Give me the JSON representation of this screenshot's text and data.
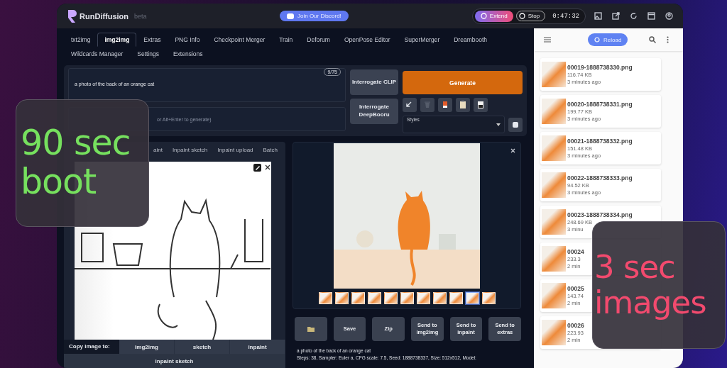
{
  "header": {
    "logo": "RunDiffusion",
    "badge": "beta",
    "discord_button": "Join Our Discord!",
    "extend_button": "Extend",
    "stop_button": "Stop",
    "timer": "0:47:32"
  },
  "tabs": [
    {
      "label": "txt2img",
      "selected": false
    },
    {
      "label": "img2img",
      "selected": true
    },
    {
      "label": "Extras",
      "selected": false
    },
    {
      "label": "PNG Info",
      "selected": false
    },
    {
      "label": "Checkpoint Merger",
      "selected": false
    },
    {
      "label": "Train",
      "selected": false
    },
    {
      "label": "Deforum",
      "selected": false
    },
    {
      "label": "OpenPose Editor",
      "selected": false
    },
    {
      "label": "SuperMerger",
      "selected": false
    },
    {
      "label": "Dreambooth",
      "selected": false
    },
    {
      "label": "Wildcards Manager",
      "selected": false
    },
    {
      "label": "Settings",
      "selected": false
    },
    {
      "label": "Extensions",
      "selected": false
    }
  ],
  "prompt": {
    "value": "a photo of the back of an orange cat",
    "counter": "9/75"
  },
  "negative_prompt": {
    "placeholder": "or Alt+Enter to generate)"
  },
  "interrogate_buttons": [
    "Interrogate CLIP",
    "Interrogate DeepBooru"
  ],
  "generate_button": "Generate",
  "styles": {
    "label": "Styles"
  },
  "input_tabs": [
    {
      "label": "aint"
    },
    {
      "label": "Inpaint sketch"
    },
    {
      "label": "Inpaint upload"
    },
    {
      "label": "Batch"
    }
  ],
  "copy_to": {
    "label": "Copy image to:",
    "buttons": [
      "img2img",
      "sketch",
      "inpaint",
      "inpaint sketch"
    ]
  },
  "thumbnails": [
    {
      "selected": false
    },
    {
      "selected": false
    },
    {
      "selected": false
    },
    {
      "selected": false
    },
    {
      "selected": false
    },
    {
      "selected": false
    },
    {
      "selected": false
    },
    {
      "selected": false
    },
    {
      "selected": false
    },
    {
      "selected": true
    },
    {
      "selected": false
    }
  ],
  "actions": [
    {
      "kind": "folder"
    },
    {
      "kind": "text",
      "label": "Save"
    },
    {
      "kind": "text",
      "label": "Zip"
    },
    {
      "kind": "text",
      "label": "Send to img2img"
    },
    {
      "kind": "text",
      "label": "Send to inpaint"
    },
    {
      "kind": "text",
      "label": "Send to extras"
    }
  ],
  "generation_info": [
    "a photo of the back of an orange cat",
    "Steps: 38, Sampler: Euler a, CFG scale: 7.5, Seed: 1888738337, Size: 512x512, Model:"
  ],
  "sidebar": {
    "reload_button": "Reload",
    "files": [
      {
        "name": "00019-1888738330.png",
        "size": "116.74 KB",
        "age": "3 minutes ago"
      },
      {
        "name": "00020-1888738331.png",
        "size": "199.77 KB",
        "age": "3 minutes ago"
      },
      {
        "name": "00021-1888738332.png",
        "size": "151.48 KB",
        "age": "3 minutes ago"
      },
      {
        "name": "00022-1888738333.png",
        "size": "94.52 KB",
        "age": "3 minutes ago"
      },
      {
        "name": "00023-1888738334.png",
        "size": "248.69 KB",
        "age": "3 minu"
      },
      {
        "name": "00024",
        "size": "233.3",
        "age": "2 min"
      },
      {
        "name": "00025",
        "size": "143.74",
        "age": "2 min"
      },
      {
        "name": "00026",
        "size": "223.93",
        "age": "2 min"
      }
    ]
  },
  "overlays": [
    {
      "lines": [
        "90 sec",
        "boot"
      ],
      "color": "#76e05e"
    },
    {
      "lines": [
        "3 sec",
        "images"
      ],
      "color": "#f24a6e"
    }
  ]
}
